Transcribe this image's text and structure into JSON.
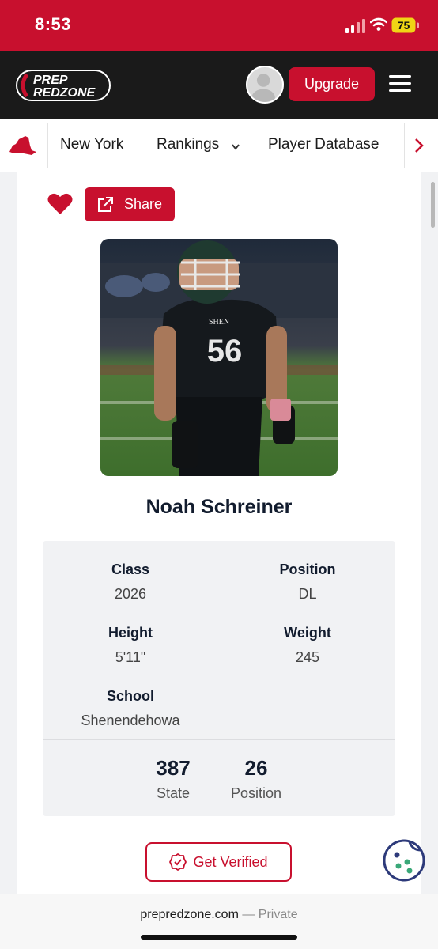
{
  "status_bar": {
    "time": "8:53",
    "battery": "75"
  },
  "header": {
    "logo_line1": "PREP",
    "logo_line2": "REDZONE",
    "upgrade_label": "Upgrade"
  },
  "nav": {
    "items": [
      {
        "label": "New York"
      },
      {
        "label": "Rankings"
      },
      {
        "label": "Player Database"
      }
    ]
  },
  "profile": {
    "share_label": "Share",
    "name": "Noah Schreiner",
    "jersey_number": "56",
    "jersey_text": "SHEN",
    "class_label": "Class",
    "class_value": "2026",
    "position_label": "Position",
    "position_value": "DL",
    "height_label": "Height",
    "height_value": "5'11\"",
    "weight_label": "Weight",
    "weight_value": "245",
    "school_label": "School",
    "school_value": "Shenendehowa",
    "state_rank": "387",
    "state_rank_label": "State",
    "position_rank": "26",
    "position_rank_label": "Position",
    "verify_label": "Get Verified"
  },
  "browser": {
    "domain": "prepredzone.com",
    "mode": " — Private"
  },
  "colors": {
    "brand_red": "#c8102e",
    "header_dark": "#1a1a1a"
  }
}
